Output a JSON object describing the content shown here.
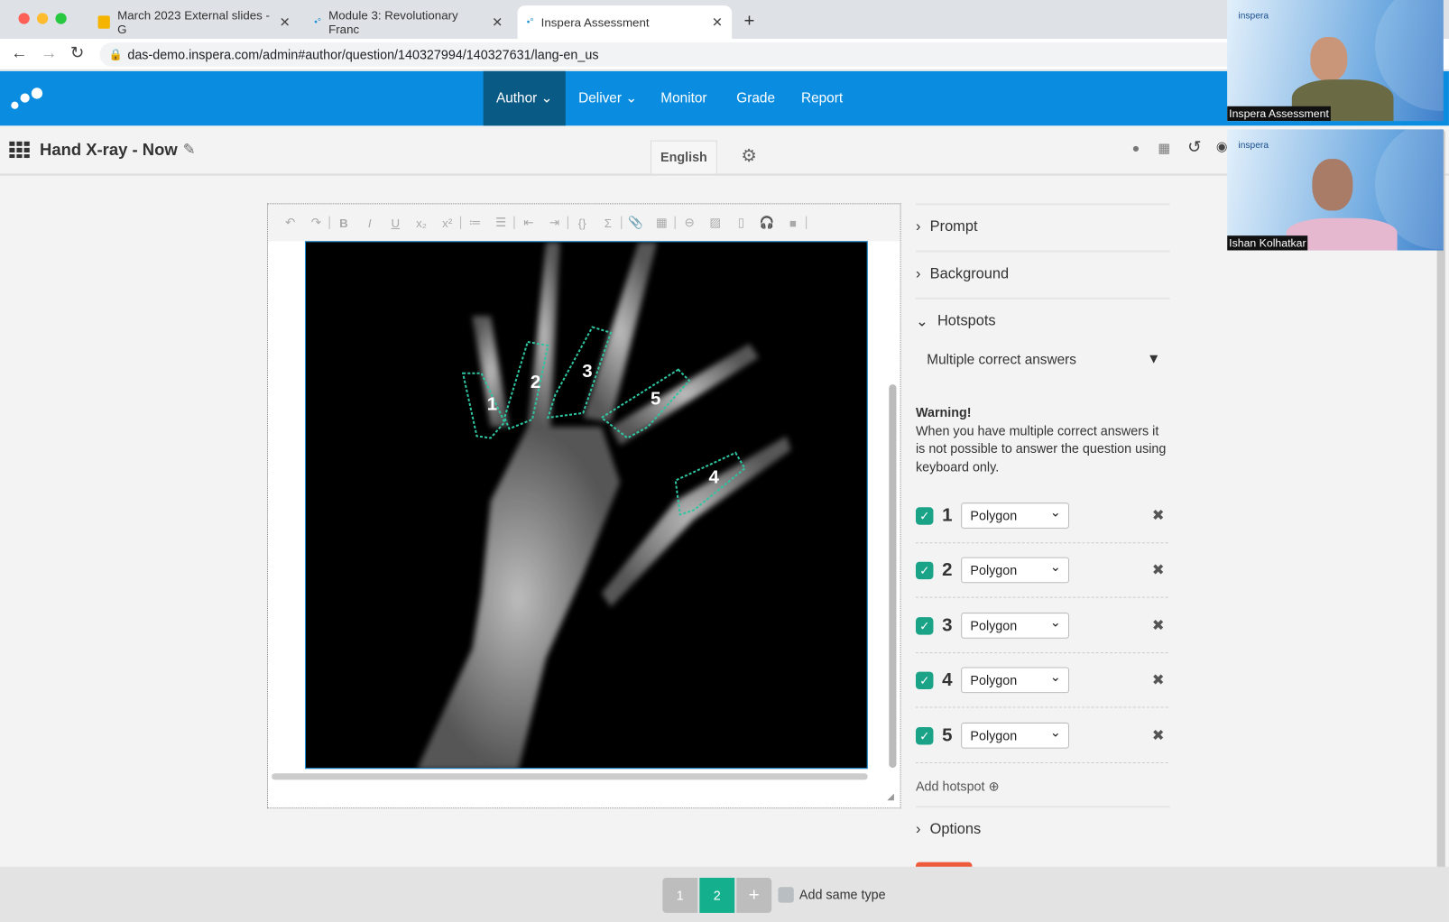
{
  "browser": {
    "tabs": [
      {
        "label": "March 2023 External slides - G"
      },
      {
        "label": "Module 3: Revolutionary Franc"
      },
      {
        "label": "Inspera Assessment"
      }
    ],
    "url": "das-demo.inspera.com/admin#author/question/140327994/140327631/lang-en_us"
  },
  "nav": {
    "items": [
      {
        "label": "Author ⌄"
      },
      {
        "label": "Deliver ⌄"
      },
      {
        "label": "Monitor"
      },
      {
        "label": "Grade"
      },
      {
        "label": "Report"
      }
    ],
    "brand_color": "#0a8de0",
    "active_color": "#0a5a86"
  },
  "header": {
    "title": "Hand X-ray - Now",
    "language": "English"
  },
  "editor": {
    "hotspot_labels": [
      "1",
      "2",
      "3",
      "5",
      "4"
    ]
  },
  "sidebar": {
    "prompt": "Prompt",
    "background": "Background",
    "hotspots": "Hotspots",
    "mode": "Multiple correct answers",
    "warning_title": "Warning!",
    "warning_text": "When you have multiple correct answers it is not possible to answer the question using keyboard only.",
    "hotspot_list": [
      {
        "num": "1",
        "shape": "Polygon",
        "checked": true
      },
      {
        "num": "2",
        "shape": "Polygon",
        "checked": true
      },
      {
        "num": "3",
        "shape": "Polygon",
        "checked": true
      },
      {
        "num": "4",
        "shape": "Polygon",
        "checked": true
      },
      {
        "num": "5",
        "shape": "Polygon",
        "checked": true
      }
    ],
    "add_hotspot": "Add hotspot",
    "options": "Options"
  },
  "footer": {
    "pages": [
      "1",
      "2"
    ],
    "add": "+",
    "add_same_type": "Add same type",
    "active_color": "#14b08d"
  },
  "video": [
    {
      "name": "Inspera Assessment",
      "logo": "inspera"
    },
    {
      "name": "Ishan Kolhatkar",
      "logo": "inspera"
    }
  ]
}
